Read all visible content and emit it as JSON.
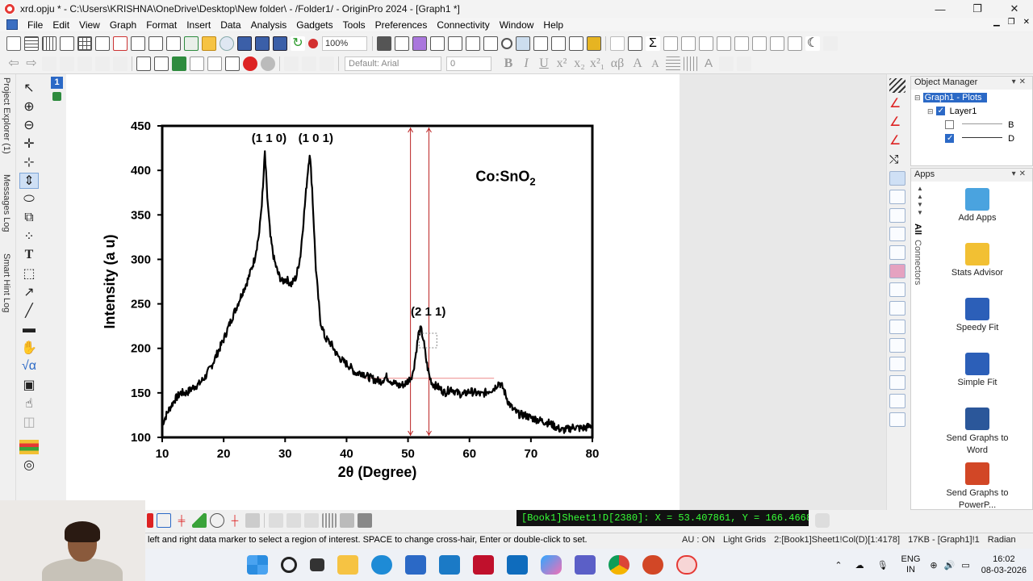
{
  "window": {
    "title": "xrd.opju * - C:\\Users\\KRISHNA\\OneDrive\\Desktop\\New folder\\ - /Folder1/ - OriginPro 2024 - [Graph1 *]",
    "controls": [
      "—",
      "❐",
      "✕"
    ]
  },
  "menu": [
    "File",
    "Edit",
    "View",
    "Graph",
    "Format",
    "Insert",
    "Data",
    "Analysis",
    "Gadgets",
    "Tools",
    "Preferences",
    "Connectivity",
    "Window",
    "Help"
  ],
  "toolbar": {
    "zoom": "100%",
    "font": "Default: Arial",
    "font_size": "0",
    "format_buttons": [
      "B",
      "I",
      "U",
      "x²",
      "x₂",
      "x²₁",
      "αβ",
      "A",
      "A"
    ]
  },
  "side_tabs": [
    "Project Explorer (1)",
    "Messages Log",
    "Smart Hint Log"
  ],
  "page_number": "1",
  "graph": {
    "annotation_title": "Co:SnO",
    "annotation_subscript": "2",
    "peak_labels": [
      "(1 1 0)",
      "(1 0 1)",
      "(2 1 1)"
    ]
  },
  "chart_data": {
    "type": "line",
    "title": "",
    "xlabel": "2θ (Degree)",
    "ylabel": "Intensity (a u)",
    "xlim": [
      10,
      80
    ],
    "ylim": [
      100,
      450
    ],
    "xticks": [
      10,
      20,
      30,
      40,
      50,
      60,
      70,
      80
    ],
    "yticks": [
      100,
      150,
      200,
      250,
      300,
      350,
      400,
      450
    ],
    "grid": false,
    "legend": "none",
    "series": [
      {
        "color": "#000000",
        "x": [
          10,
          11,
          12,
          13,
          14,
          15,
          16,
          17,
          18,
          19,
          20,
          21,
          22,
          23,
          24,
          25,
          25.8,
          26.4,
          26.7,
          27.1,
          27.6,
          28.2,
          28.8,
          29.5,
          30.2,
          31,
          31.8,
          32.5,
          33.2,
          33.7,
          34,
          34.4,
          35,
          35.7,
          36.5,
          37.5,
          38.5,
          39.5,
          40.5,
          41.5,
          42.5,
          43.5,
          44.5,
          45.5,
          46.5,
          47.5,
          48.5,
          49.5,
          50.2,
          50.8,
          51.3,
          51.7,
          52.1,
          52.5,
          53,
          53.5,
          54,
          55,
          56,
          57,
          58,
          59,
          60,
          61,
          62,
          63,
          64,
          64.8,
          65.5,
          66.3,
          67,
          68,
          69,
          70,
          71,
          72,
          73,
          74,
          75,
          76,
          77,
          78,
          79,
          80
        ],
        "y": [
          115,
          130,
          142,
          150,
          150,
          156,
          160,
          168,
          180,
          195,
          210,
          228,
          245,
          262,
          278,
          300,
          330,
          380,
          420,
          370,
          325,
          300,
          285,
          275,
          278,
          272,
          280,
          305,
          360,
          400,
          420,
          380,
          290,
          232,
          212,
          205,
          192,
          185,
          180,
          172,
          173,
          168,
          165,
          163,
          168,
          162,
          158,
          160,
          165,
          172,
          195,
          216,
          222,
          210,
          185,
          168,
          160,
          156,
          150,
          155,
          150,
          148,
          152,
          150,
          148,
          152,
          155,
          162,
          155,
          140,
          132,
          126,
          125,
          122,
          120,
          118,
          116,
          112,
          108,
          109,
          112,
          110,
          111,
          114
        ]
      }
    ],
    "markers": {
      "vertical_lines_x": [
        50.4,
        53.4
      ],
      "horizontal_line_y": 166.47,
      "horizontal_line_span": [
        43,
        64
      ]
    }
  },
  "object_manager": {
    "title": "Object Manager",
    "root": "Graph1 - Plots",
    "layer": "Layer1",
    "plots": [
      {
        "name": "B",
        "checked": false
      },
      {
        "name": "D",
        "checked": true
      }
    ]
  },
  "apps": {
    "title": "Apps",
    "side_tabs": [
      "All",
      "Connectors"
    ],
    "items": [
      {
        "label": "Add Apps",
        "color": "#4aa3df"
      },
      {
        "label": "Stats Advisor",
        "color": "#f2c033"
      },
      {
        "label": "Speedy Fit",
        "color": "#2c5fb8"
      },
      {
        "label": "Simple Fit",
        "color": "#2c5fb8"
      },
      {
        "label": "Send Graphs to Word",
        "color": "#2b579a"
      },
      {
        "label": "Send Graphs to PowerP...",
        "color": "#d24726"
      },
      {
        "label": "",
        "color": "#3aa33a"
      }
    ]
  },
  "readout": "[Book1]Sheet1!D[2380]:  X = 53.407861, Y = 166.46686",
  "status": {
    "hint": "left and right data marker to select a region of interest. SPACE to change cross-hair, Enter or double-click to set.",
    "items": [
      "AU : ON",
      "Light Grids",
      "2:[Book1]Sheet1!Col(D)[1:4178]",
      "17KB - [Graph1]!1",
      "Radian"
    ]
  },
  "taskbar": {
    "lang_top": "ENG",
    "lang_bottom": "IN",
    "time": "16:02",
    "date": "08-03-2026"
  }
}
